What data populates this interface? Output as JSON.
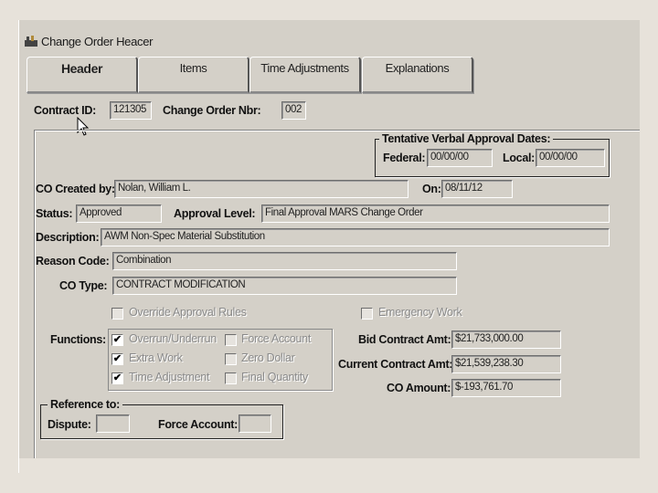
{
  "window": {
    "title": "Change Order Heacer"
  },
  "tabs": [
    {
      "label": "Header",
      "active": true
    },
    {
      "label": "Items"
    },
    {
      "label": "Time Adjustments"
    },
    {
      "label": "Explanations"
    }
  ],
  "header": {
    "contract_id_label": "Contract ID:",
    "contract_id_value": "121305",
    "change_order_nbr_label": "Change Order Nbr:",
    "change_order_nbr_value": "002"
  },
  "tentative": {
    "title": "Tentative Verbal Approval Dates:",
    "federal_label": "Federal:",
    "federal_value": "00/00/00",
    "local_label": "Local:",
    "local_value": "00/00/00"
  },
  "form": {
    "created_by_label": "CO Created by:",
    "created_by_value": "Nolan, William L.",
    "on_label": "On:",
    "on_value": "08/11/12",
    "status_label": "Status:",
    "status_value": "Approved",
    "approval_level_label": "Approval Level:",
    "approval_level_value": "Final Approval MARS Change Order",
    "description_label": "Description:",
    "description_value": "AWM Non-Spec Material Substitution",
    "reason_code_label": "Reason Code:",
    "reason_code_value": "Combination",
    "co_type_label": "CO Type:",
    "co_type_value": "CONTRACT MODIFICATION"
  },
  "options": {
    "override_label": "Override Approval Rules",
    "emergency_label": "Emergency Work"
  },
  "functions": {
    "label": "Functions:",
    "items": [
      {
        "label": "Overrun/Underrun",
        "checked": true
      },
      {
        "label": "Force Account",
        "checked": false
      },
      {
        "label": "Extra Work",
        "checked": true
      },
      {
        "label": "Zero Dollar",
        "checked": false
      },
      {
        "label": "Time Adjustment",
        "checked": true
      },
      {
        "label": "Final Quantity",
        "checked": false
      }
    ]
  },
  "amounts": {
    "bid_label": "Bid Contract Amt:",
    "bid_value": "$21,733,000.00",
    "current_label": "Current Contract Amt:",
    "current_value": "$21,539,238.30",
    "co_label": "CO Amount:",
    "co_value": "$-193,761.70"
  },
  "reference": {
    "title": "Reference to:",
    "dispute_label": "Dispute:",
    "dispute_value": "",
    "force_account_label": "Force Account:",
    "force_account_value": ""
  },
  "check_mark": "✔"
}
